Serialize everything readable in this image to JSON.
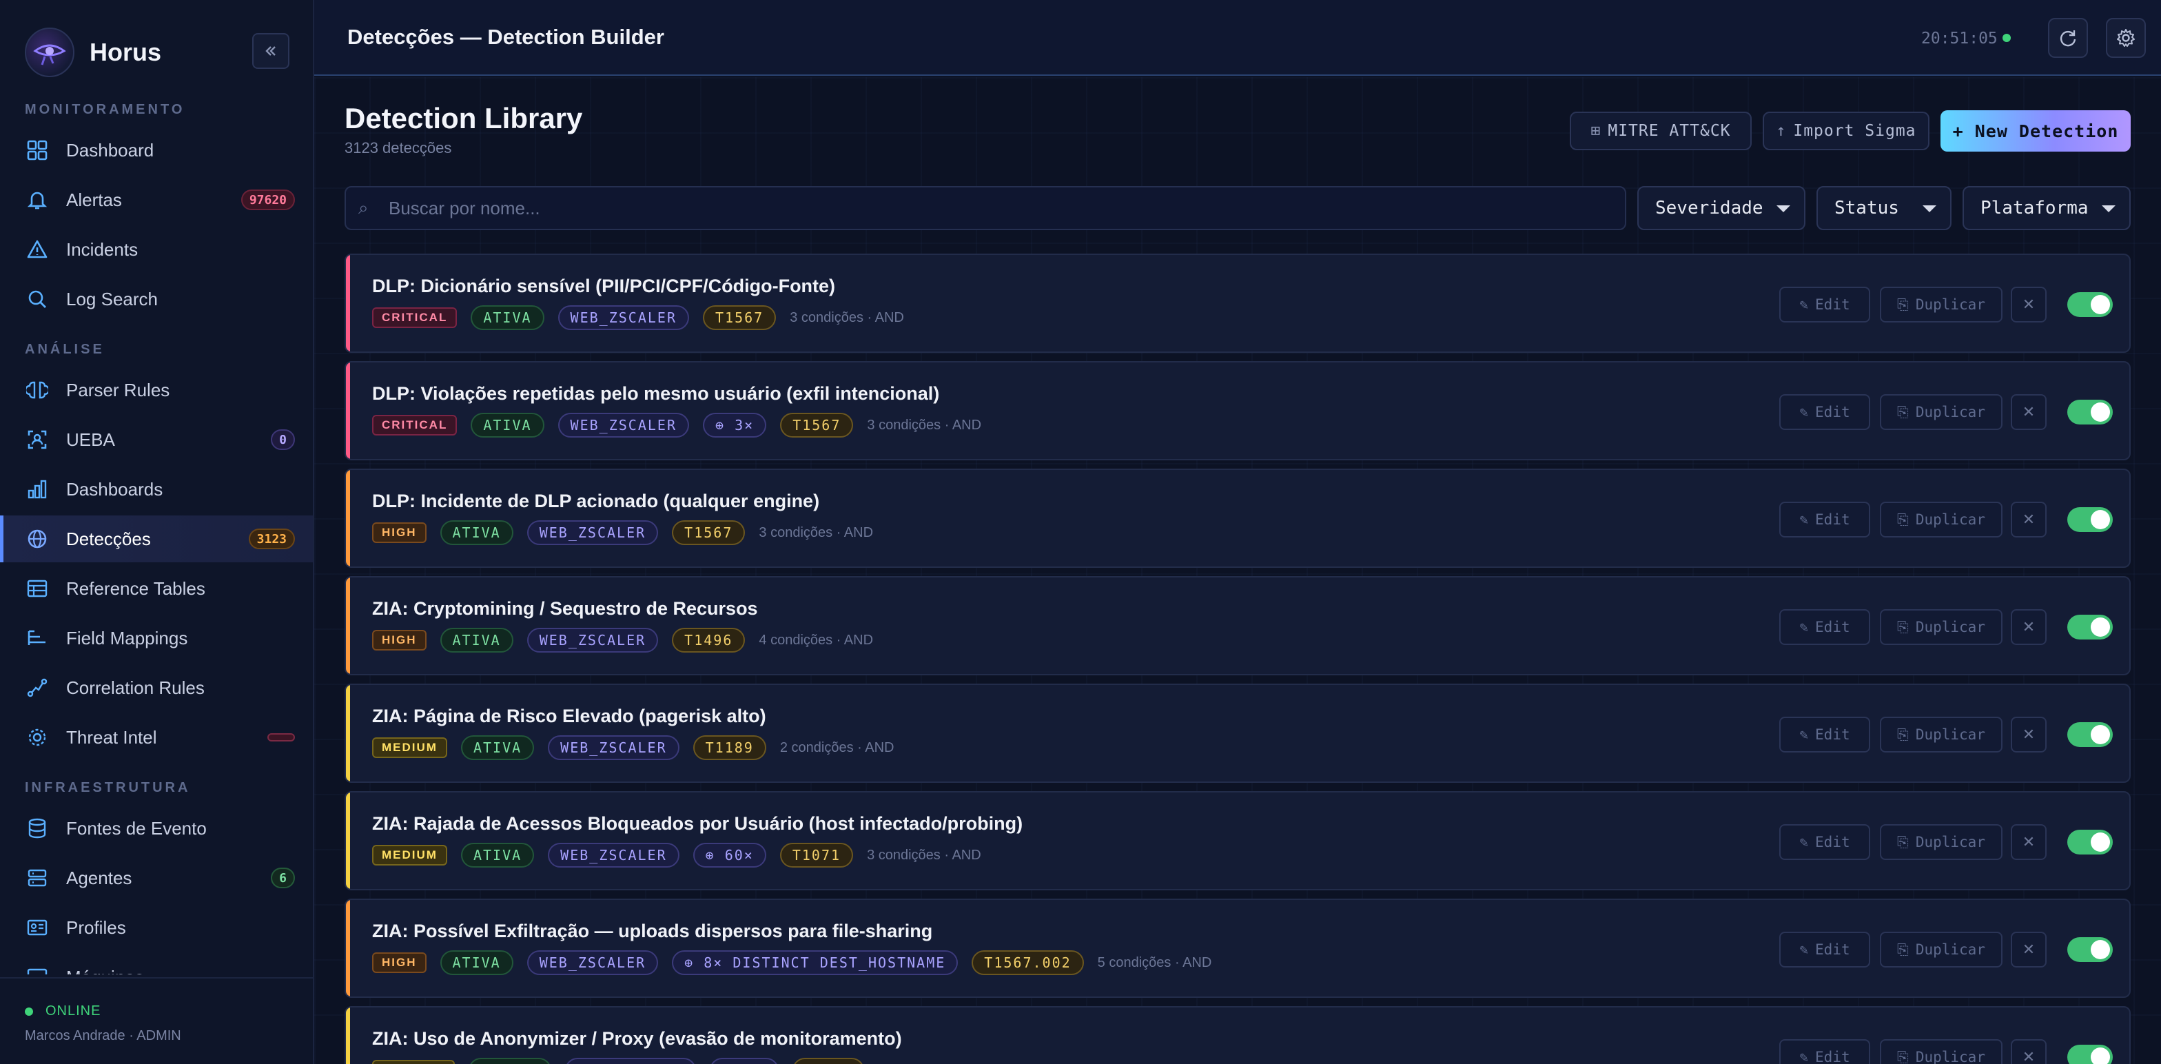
{
  "app": {
    "name": "Horus",
    "status": "ONLINE",
    "user": "Marcos Andrade · ADMIN"
  },
  "colors": {
    "accent": "#5b8cff",
    "critical": "#ff5a86",
    "high": "#ff9a3c",
    "medium": "#f5d142",
    "online": "#3fd47a"
  },
  "sidebar": {
    "sections": [
      {
        "label": "MONITORAMENTO"
      },
      {
        "label": "ANÁLISE"
      },
      {
        "label": "INFRAESTRUTURA"
      }
    ],
    "items": [
      {
        "label": "Dashboard",
        "icon": "grid-icon"
      },
      {
        "label": "Alertas",
        "icon": "bell-icon",
        "badge": "97620"
      },
      {
        "label": "Incidents",
        "icon": "warning-triangle-icon"
      },
      {
        "label": "Log Search",
        "icon": "search-icon"
      },
      {
        "label": "Parser Rules",
        "icon": "brain-icon"
      },
      {
        "label": "UEBA",
        "icon": "user-scan-icon",
        "badge": "0"
      },
      {
        "label": "Dashboards",
        "icon": "bar-chart-icon"
      },
      {
        "label": "Detecções",
        "icon": "globe-icon",
        "badge": "3123"
      },
      {
        "label": "Reference Tables",
        "icon": "table-icon"
      },
      {
        "label": "Field Mappings",
        "icon": "mapping-icon"
      },
      {
        "label": "Correlation Rules",
        "icon": "trend-icon"
      },
      {
        "label": "Threat Intel",
        "icon": "gear-icon"
      },
      {
        "label": "Fontes de Evento",
        "icon": "database-icon"
      },
      {
        "label": "Agentes",
        "icon": "server-icon",
        "badge": "6"
      },
      {
        "label": "Profiles",
        "icon": "id-card-icon"
      },
      {
        "label": "Máquinas",
        "icon": "monitor-icon"
      }
    ]
  },
  "header": {
    "title": "Detecções — Detection Builder",
    "clock": "20:51:05"
  },
  "page": {
    "title": "Detection Library",
    "count_label": "3123 detecções",
    "buttons": {
      "mitre": "MITRE ATT&CK",
      "import": "Import Sigma",
      "new": "+ New Detection"
    },
    "search_placeholder": "Buscar por nome...",
    "search_value": "",
    "filters": {
      "severity": "Severidade",
      "status": "Status",
      "platform": "Plataforma"
    }
  },
  "actions": {
    "edit": "Edit",
    "duplicate": "Duplicar"
  },
  "rules": [
    {
      "title": "DLP: Dicionário sensível (PII/PCI/CPF/Código-Fonte)",
      "severity": "CRITICAL",
      "status": "ATIVA",
      "source": "WEB_ZSCALER",
      "threshold": "",
      "mitre": "T1567",
      "meta": "3 condições · AND"
    },
    {
      "title": "DLP: Violações repetidas pelo mesmo usuário (exfil intencional)",
      "severity": "CRITICAL",
      "status": "ATIVA",
      "source": "WEB_ZSCALER",
      "threshold": "3×",
      "mitre": "T1567",
      "meta": "3 condições · AND"
    },
    {
      "title": "DLP: Incidente de DLP acionado (qualquer engine)",
      "severity": "HIGH",
      "status": "ATIVA",
      "source": "WEB_ZSCALER",
      "threshold": "",
      "mitre": "T1567",
      "meta": "3 condições · AND"
    },
    {
      "title": "ZIA: Cryptomining / Sequestro de Recursos",
      "severity": "HIGH",
      "status": "ATIVA",
      "source": "WEB_ZSCALER",
      "threshold": "",
      "mitre": "T1496",
      "meta": "4 condições · AND"
    },
    {
      "title": "ZIA: Página de Risco Elevado (pagerisk alto)",
      "severity": "MEDIUM",
      "status": "ATIVA",
      "source": "WEB_ZSCALER",
      "threshold": "",
      "mitre": "T1189",
      "meta": "2 condições · AND"
    },
    {
      "title": "ZIA: Rajada de Acessos Bloqueados por Usuário (host infectado/probing)",
      "severity": "MEDIUM",
      "status": "ATIVA",
      "source": "WEB_ZSCALER",
      "threshold": "60×",
      "mitre": "T1071",
      "meta": "3 condições · AND"
    },
    {
      "title": "ZIA: Possível Exfiltração — uploads dispersos para file-sharing",
      "severity": "HIGH",
      "status": "ATIVA",
      "source": "WEB_ZSCALER",
      "threshold": "8× DISTINCT DEST_HOSTNAME",
      "mitre": "T1567.002",
      "meta": "5 condições · AND"
    },
    {
      "title": "ZIA: Uso de Anonymizer / Proxy (evasão de monitoramento)",
      "severity": "",
      "status": "",
      "source": "",
      "threshold": "",
      "mitre": "",
      "meta": ""
    }
  ]
}
